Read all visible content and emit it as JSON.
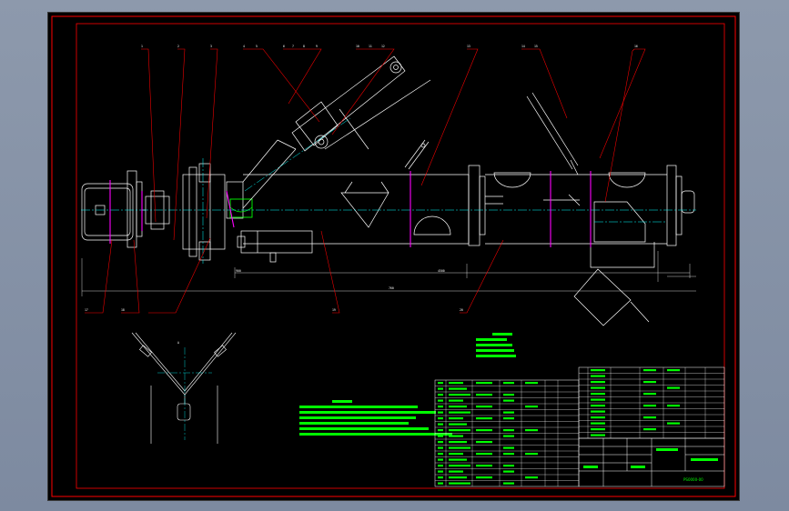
{
  "app": {
    "background_color": "#8592a6",
    "sheet_color": "#000000"
  },
  "drawing": {
    "frame_color": "#ff0000",
    "geometry_color": "#ffffff",
    "centerline_color": "#00ffff",
    "leader_color": "#ff0000",
    "annotation_color": "#00ff00",
    "marker_color": "#ff00ff",
    "balloon_labels": [
      "1",
      "2",
      "3",
      "4",
      "5",
      "6",
      "7",
      "8",
      "9",
      "10",
      "11",
      "12",
      "13",
      "14",
      "15",
      "16",
      "17",
      "18",
      "19",
      "20"
    ],
    "dimensions": {
      "left_span": "900",
      "overall_length": "4500",
      "short_span": "760"
    },
    "view_label_a": "A",
    "view_label_b": "B",
    "drawing_number": "PS0000-00"
  }
}
